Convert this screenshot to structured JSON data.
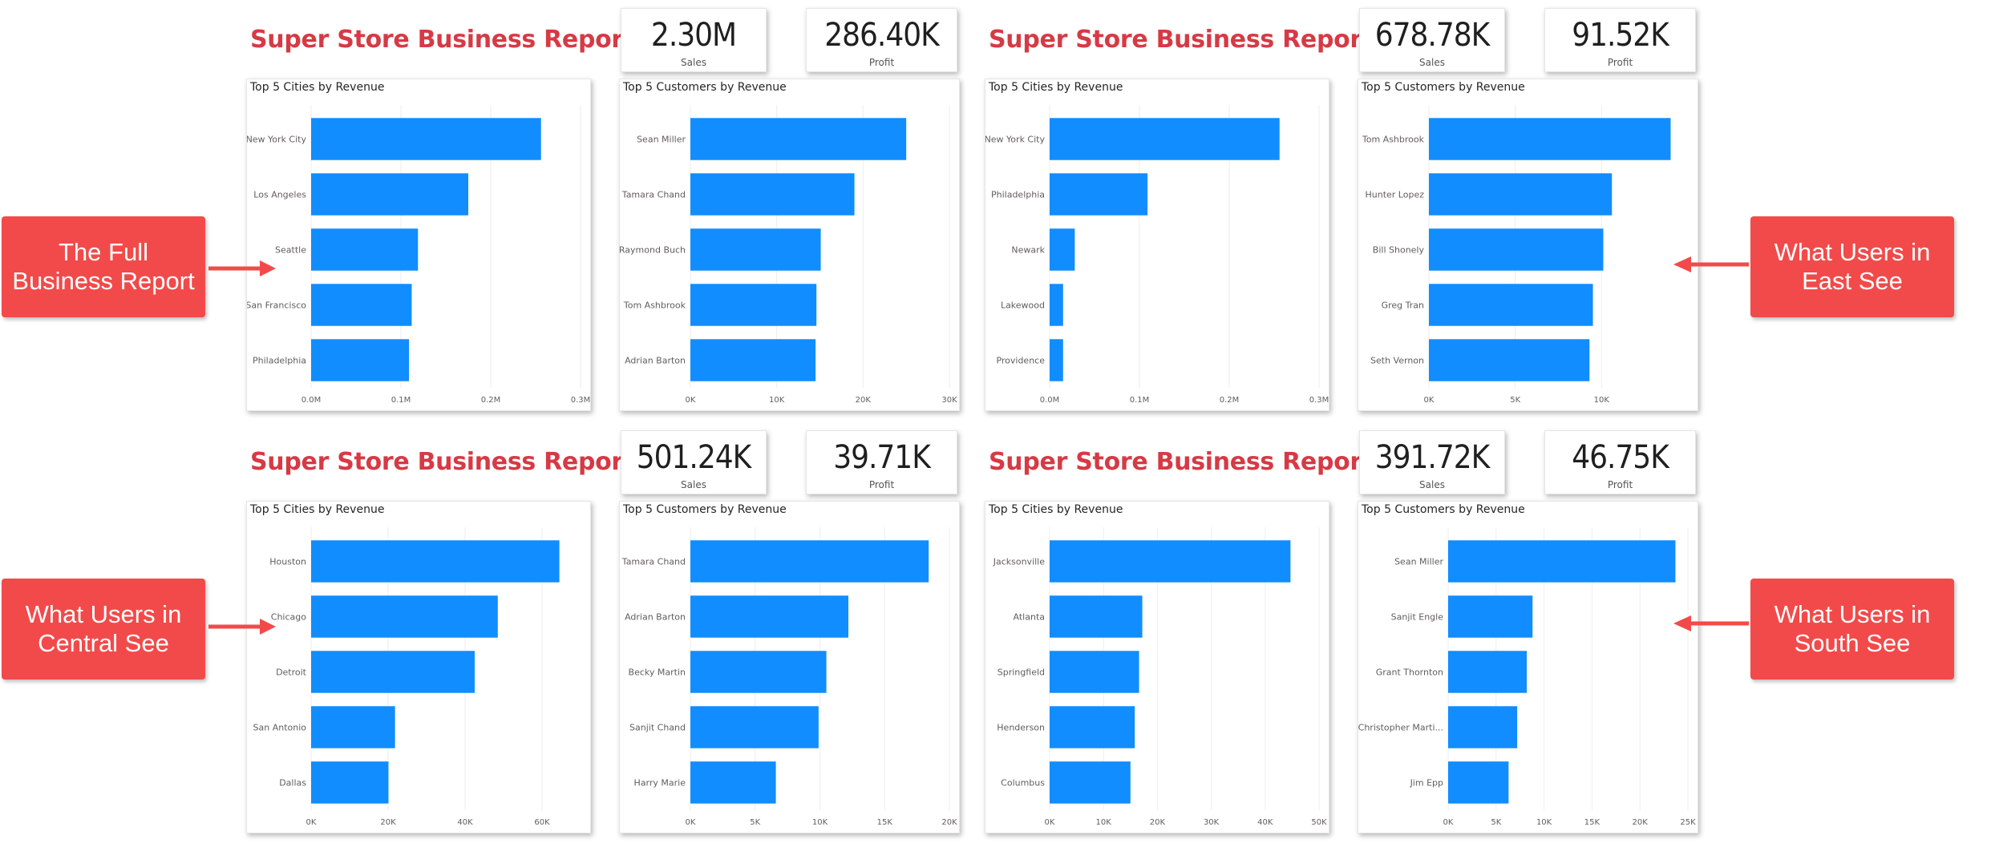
{
  "colors": {
    "bar": "#118dff",
    "title": "#d63a45",
    "callout": "#f24a4a"
  },
  "reports": [
    {
      "id": "full",
      "title": "Super Store Business Report",
      "kpis": {
        "sales_value": "2.30M",
        "sales_label": "Sales",
        "profit_value": "286.40K",
        "profit_label": "Profit"
      },
      "callout": "The Full Business Report"
    },
    {
      "id": "east",
      "title": "Super Store Business Report",
      "kpis": {
        "sales_value": "678.78K",
        "sales_label": "Sales",
        "profit_value": "91.52K",
        "profit_label": "Profit"
      },
      "callout": "What Users in East See"
    },
    {
      "id": "central",
      "title": "Super Store Business Report",
      "kpis": {
        "sales_value": "501.24K",
        "sales_label": "Sales",
        "profit_value": "39.71K",
        "profit_label": "Profit"
      },
      "callout": "What Users in Central See"
    },
    {
      "id": "south",
      "title": "Super Store Business Report",
      "kpis": {
        "sales_value": "391.72K",
        "sales_label": "Sales",
        "profit_value": "46.75K",
        "profit_label": "Profit"
      },
      "callout": "What Users in South See"
    }
  ],
  "chart_data": [
    {
      "type": "bar",
      "orientation": "horizontal",
      "title": "Top 5 Cities by Revenue",
      "categories": [
        "New York City",
        "Los Angeles",
        "Seattle",
        "San Francisco",
        "Philadelphia"
      ],
      "values": [
        256000,
        175000,
        119000,
        112000,
        109000
      ],
      "xlim": [
        0,
        300000
      ],
      "ticks": [
        0,
        100000,
        200000,
        300000
      ],
      "tick_labels": [
        "0.0M",
        "0.1M",
        "0.2M",
        "0.3M"
      ],
      "grid": true
    },
    {
      "type": "bar",
      "orientation": "horizontal",
      "title": "Top 5 Customers by Revenue",
      "categories": [
        "Sean Miller",
        "Tamara Chand",
        "Raymond Buch",
        "Tom Ashbrook",
        "Adrian Barton"
      ],
      "values": [
        25000,
        19000,
        15100,
        14600,
        14500
      ],
      "xlim": [
        0,
        30000
      ],
      "ticks": [
        0,
        10000,
        20000,
        30000
      ],
      "tick_labels": [
        "0K",
        "10K",
        "20K",
        "30K"
      ],
      "grid": true
    },
    {
      "type": "bar",
      "orientation": "horizontal",
      "title": "Top 5 Cities by Revenue",
      "categories": [
        "New York City",
        "Philadelphia",
        "Newark",
        "Lakewood",
        "Providence"
      ],
      "values": [
        256000,
        109000,
        28000,
        15000,
        15000
      ],
      "xlim": [
        0,
        300000
      ],
      "ticks": [
        0,
        100000,
        200000,
        300000
      ],
      "tick_labels": [
        "0.0M",
        "0.1M",
        "0.2M",
        "0.3M"
      ],
      "grid": true
    },
    {
      "type": "bar",
      "orientation": "horizontal",
      "title": "Top 5 Customers by Revenue",
      "categories": [
        "Tom Ashbrook",
        "Hunter Lopez",
        "Bill Shonely",
        "Greg Tran",
        "Seth Vernon"
      ],
      "values": [
        14000,
        10600,
        10100,
        9500,
        9300
      ],
      "xlim": [
        0,
        15000
      ],
      "ticks": [
        0,
        5000,
        10000
      ],
      "tick_labels": [
        "0K",
        "5K",
        "10K"
      ],
      "grid": true
    },
    {
      "type": "bar",
      "orientation": "horizontal",
      "title": "Top 5 Cities by Revenue",
      "categories": [
        "Houston",
        "Chicago",
        "Detroit",
        "San Antonio",
        "Dallas"
      ],
      "values": [
        64500,
        48500,
        42500,
        21800,
        20100
      ],
      "xlim": [
        0,
        70000
      ],
      "ticks": [
        0,
        20000,
        40000,
        60000
      ],
      "tick_labels": [
        "0K",
        "20K",
        "40K",
        "60K"
      ],
      "grid": true
    },
    {
      "type": "bar",
      "orientation": "horizontal",
      "title": "Top 5 Customers by Revenue",
      "categories": [
        "Tamara Chand",
        "Adrian Barton",
        "Becky Martin",
        "Sanjit Chand",
        "Harry Marie"
      ],
      "values": [
        18400,
        12200,
        10500,
        9900,
        6600
      ],
      "xlim": [
        0,
        20000
      ],
      "ticks": [
        0,
        5000,
        10000,
        15000,
        20000
      ],
      "tick_labels": [
        "0K",
        "5K",
        "10K",
        "15K",
        "20K"
      ],
      "grid": true
    },
    {
      "type": "bar",
      "orientation": "horizontal",
      "title": "Top 5 Cities by Revenue",
      "categories": [
        "Jacksonville",
        "Atlanta",
        "Springfield",
        "Henderson",
        "Columbus"
      ],
      "values": [
        44700,
        17200,
        16600,
        15800,
        15000
      ],
      "xlim": [
        0,
        50000
      ],
      "ticks": [
        0,
        10000,
        20000,
        30000,
        40000,
        50000
      ],
      "tick_labels": [
        "0K",
        "10K",
        "20K",
        "30K",
        "40K",
        "50K"
      ],
      "grid": true
    },
    {
      "type": "bar",
      "orientation": "horizontal",
      "title": "Top 5 Customers by Revenue",
      "categories": [
        "Sean Miller",
        "Sanjit Engle",
        "Grant Thornton",
        "Christopher Marti...",
        "Jim Epp"
      ],
      "values": [
        23700,
        8800,
        8200,
        7200,
        6300
      ],
      "xlim": [
        0,
        25000
      ],
      "ticks": [
        0,
        5000,
        10000,
        15000,
        20000,
        25000
      ],
      "tick_labels": [
        "0K",
        "5K",
        "10K",
        "15K",
        "20K",
        "25K"
      ],
      "grid": true
    }
  ]
}
